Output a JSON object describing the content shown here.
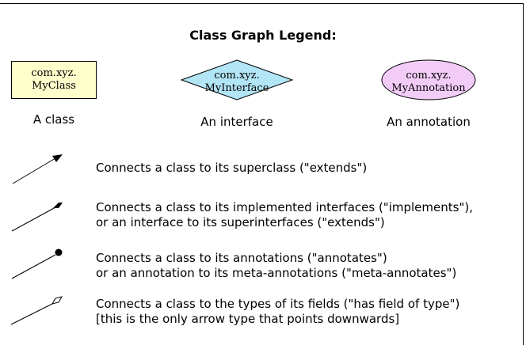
{
  "legend": {
    "title": "Class Graph Legend:"
  },
  "nodes": [
    {
      "line1": "com.xyz.",
      "line2": "MyClass",
      "caption": "A class"
    },
    {
      "line1": "com.xyz.",
      "line2": "MyInterface",
      "caption": "An interface"
    },
    {
      "line1": "com.xyz.",
      "line2": "MyAnnotation",
      "caption": "An annotation"
    }
  ],
  "edges": [
    {
      "head": "triangle",
      "lines": [
        "Connects a class to its superclass (\"extends\")"
      ]
    },
    {
      "head": "diamond-filled",
      "lines": [
        "Connects a class to its implemented interfaces (\"implements\"),",
        "or an interface to its superinterfaces (\"extends\")"
      ]
    },
    {
      "head": "dot",
      "lines": [
        "Connects a class to its annotations (\"annotates\")",
        "or an annotation to its meta-annotations (\"meta-annotates\")"
      ]
    },
    {
      "head": "diamond-open",
      "lines": [
        "Connects a class to the types of its fields (\"has field of type\")",
        "[this is the only arrow type that points downwards]"
      ]
    }
  ],
  "colors": {
    "class_fill": "#ffffcc",
    "interface_fill": "#b2e5f5",
    "annotation_fill": "#f2ccf7",
    "stroke": "#000000"
  }
}
